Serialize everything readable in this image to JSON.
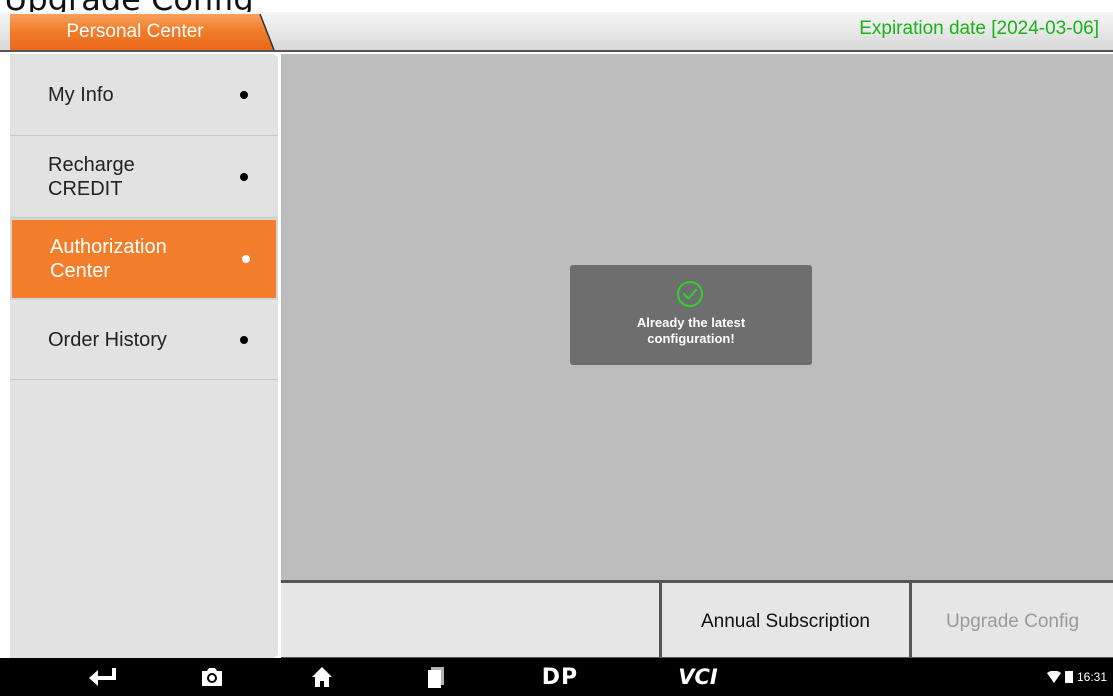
{
  "page_heading_clipped": "Upgrade Config",
  "header": {
    "tab_label": "Personal Center",
    "expiration": "Expiration date [2024-03-06]"
  },
  "sidebar": {
    "items": [
      {
        "label": "My Info",
        "active": false
      },
      {
        "label": "Recharge\nCREDIT",
        "active": false
      },
      {
        "label": "Authorization\nCenter",
        "active": true
      },
      {
        "label": "Order History",
        "active": false
      }
    ]
  },
  "toast": {
    "icon": "check-circle-icon",
    "message": "Already the latest\nconfiguration!"
  },
  "bottom_buttons": {
    "blank": "",
    "annual_subscription": "Annual Subscription",
    "upgrade_config": "Upgrade Config"
  },
  "navbar": {
    "icons": [
      "back-icon",
      "camera-icon",
      "home-icon",
      "recent-apps-icon",
      "dp-logo-icon",
      "vci-icon"
    ],
    "dp_text": "DP",
    "vci_text": "VCI",
    "time": "16:31"
  },
  "colors": {
    "accent": "#f27e2b",
    "expiration_green": "#17b317",
    "content_bg": "#bdbdbd",
    "toast_bg": "#6e6e6e",
    "disabled_text": "#9a9a9a"
  }
}
